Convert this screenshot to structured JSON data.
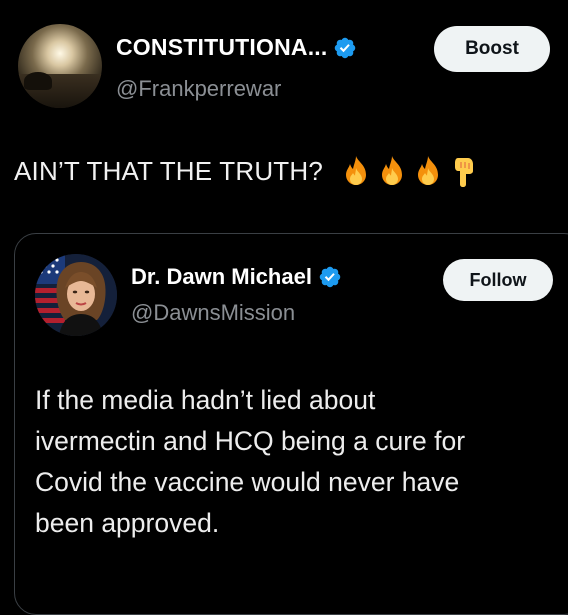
{
  "post": {
    "author": {
      "display_name": "CONSTITUTIONA...",
      "handle": "@Frankperrewar",
      "verified": true
    },
    "boost_label": "Boost",
    "text": "AIN’T THAT THE TRUTH?",
    "emojis": [
      "fire-emoji",
      "fire-emoji",
      "fire-emoji",
      "pointing-down-emoji"
    ]
  },
  "quoted": {
    "author": {
      "display_name": "Dr. Dawn Michael",
      "handle": "@DawnsMission",
      "verified": true
    },
    "follow_label": "Follow",
    "text_lines": [
      "If the media hadn’t lied about",
      "ivermectin and HCQ being a cure for",
      "Covid the vaccine would never have",
      "been approved."
    ]
  },
  "colors": {
    "background": "#000000",
    "verified_blue": "#1d9bf0",
    "handle_gray": "#8b8f94",
    "button_bg": "#eff3f4",
    "button_text": "#0f1419",
    "card_border": "#3a3f44"
  }
}
